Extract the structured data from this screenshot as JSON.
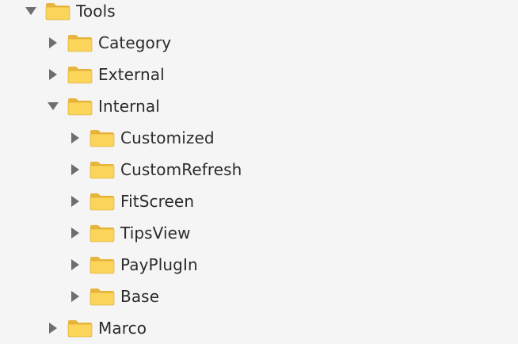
{
  "colors": {
    "background": "#f5f5f5",
    "text": "#2b2b2b",
    "disclosure": "#6e6e6e",
    "folder_back": "#e8b53c",
    "folder_front": "#fbd45a",
    "folder_edge": "#d9a52f"
  },
  "icons": {
    "expanded": "disclosure-expanded-icon",
    "collapsed": "disclosure-collapsed-icon",
    "folder": "folder-icon"
  },
  "tree": [
    {
      "label": "Tools",
      "depth": 0,
      "expanded": true
    },
    {
      "label": "Category",
      "depth": 1,
      "expanded": false
    },
    {
      "label": "External",
      "depth": 1,
      "expanded": false
    },
    {
      "label": "Internal",
      "depth": 1,
      "expanded": true
    },
    {
      "label": "Customized",
      "depth": 2,
      "expanded": false
    },
    {
      "label": "CustomRefresh",
      "depth": 2,
      "expanded": false
    },
    {
      "label": "FitScreen",
      "depth": 2,
      "expanded": false
    },
    {
      "label": "TipsView",
      "depth": 2,
      "expanded": false
    },
    {
      "label": "PayPlugIn",
      "depth": 2,
      "expanded": false
    },
    {
      "label": "Base",
      "depth": 2,
      "expanded": false
    },
    {
      "label": "Marco",
      "depth": 1,
      "expanded": false
    }
  ]
}
